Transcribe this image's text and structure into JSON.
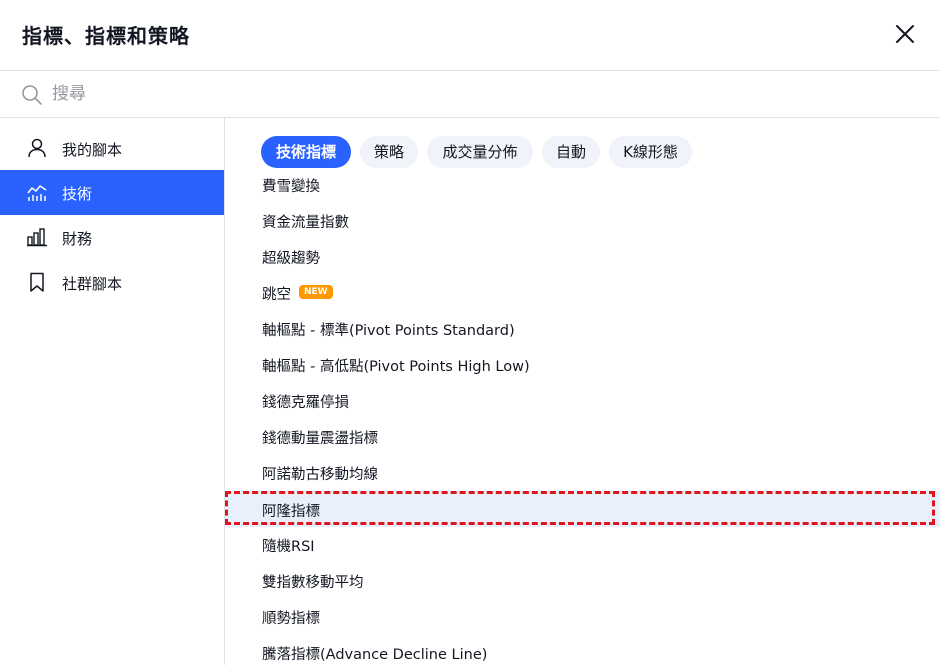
{
  "dialog": {
    "title": "指標、指標和策略"
  },
  "search": {
    "placeholder": "搜尋"
  },
  "sidebar": {
    "items": [
      {
        "label": "我的腳本",
        "icon": "user-icon"
      },
      {
        "label": "技術",
        "icon": "chart-line-icon"
      },
      {
        "label": "財務",
        "icon": "bar-chart-icon"
      },
      {
        "label": "社群腳本",
        "icon": "bookmark-icon"
      }
    ],
    "active_index": 1
  },
  "tabs": [
    {
      "label": "技術指標"
    },
    {
      "label": "策略"
    },
    {
      "label": "成交量分佈"
    },
    {
      "label": "自動"
    },
    {
      "label": "K線形態"
    }
  ],
  "list": {
    "items": [
      {
        "label": "費雪變換"
      },
      {
        "label": "資金流量指數"
      },
      {
        "label": "超級趨勢"
      },
      {
        "label": "跳空",
        "badge": "NEW"
      },
      {
        "label": "軸樞點 - 標準(Pivot Points Standard)"
      },
      {
        "label": "軸樞點 - 高低點(Pivot Points High Low)"
      },
      {
        "label": "錢德克羅停損"
      },
      {
        "label": "錢德動量震盪指標"
      },
      {
        "label": "阿諾勒古移動均線"
      },
      {
        "label": "阿隆指標"
      },
      {
        "label": "隨機RSI"
      },
      {
        "label": "雙指數移動平均"
      },
      {
        "label": "順勢指標"
      },
      {
        "label": "騰落指標(Advance Decline Line)"
      }
    ],
    "highlighted_index": 9
  },
  "colors": {
    "accent": "#2962ff",
    "chip_bg": "#f0f3fa",
    "highlight_bg": "#e8f0fc",
    "new_badge": "#ff9800",
    "annotation_box": "#e0141e"
  }
}
